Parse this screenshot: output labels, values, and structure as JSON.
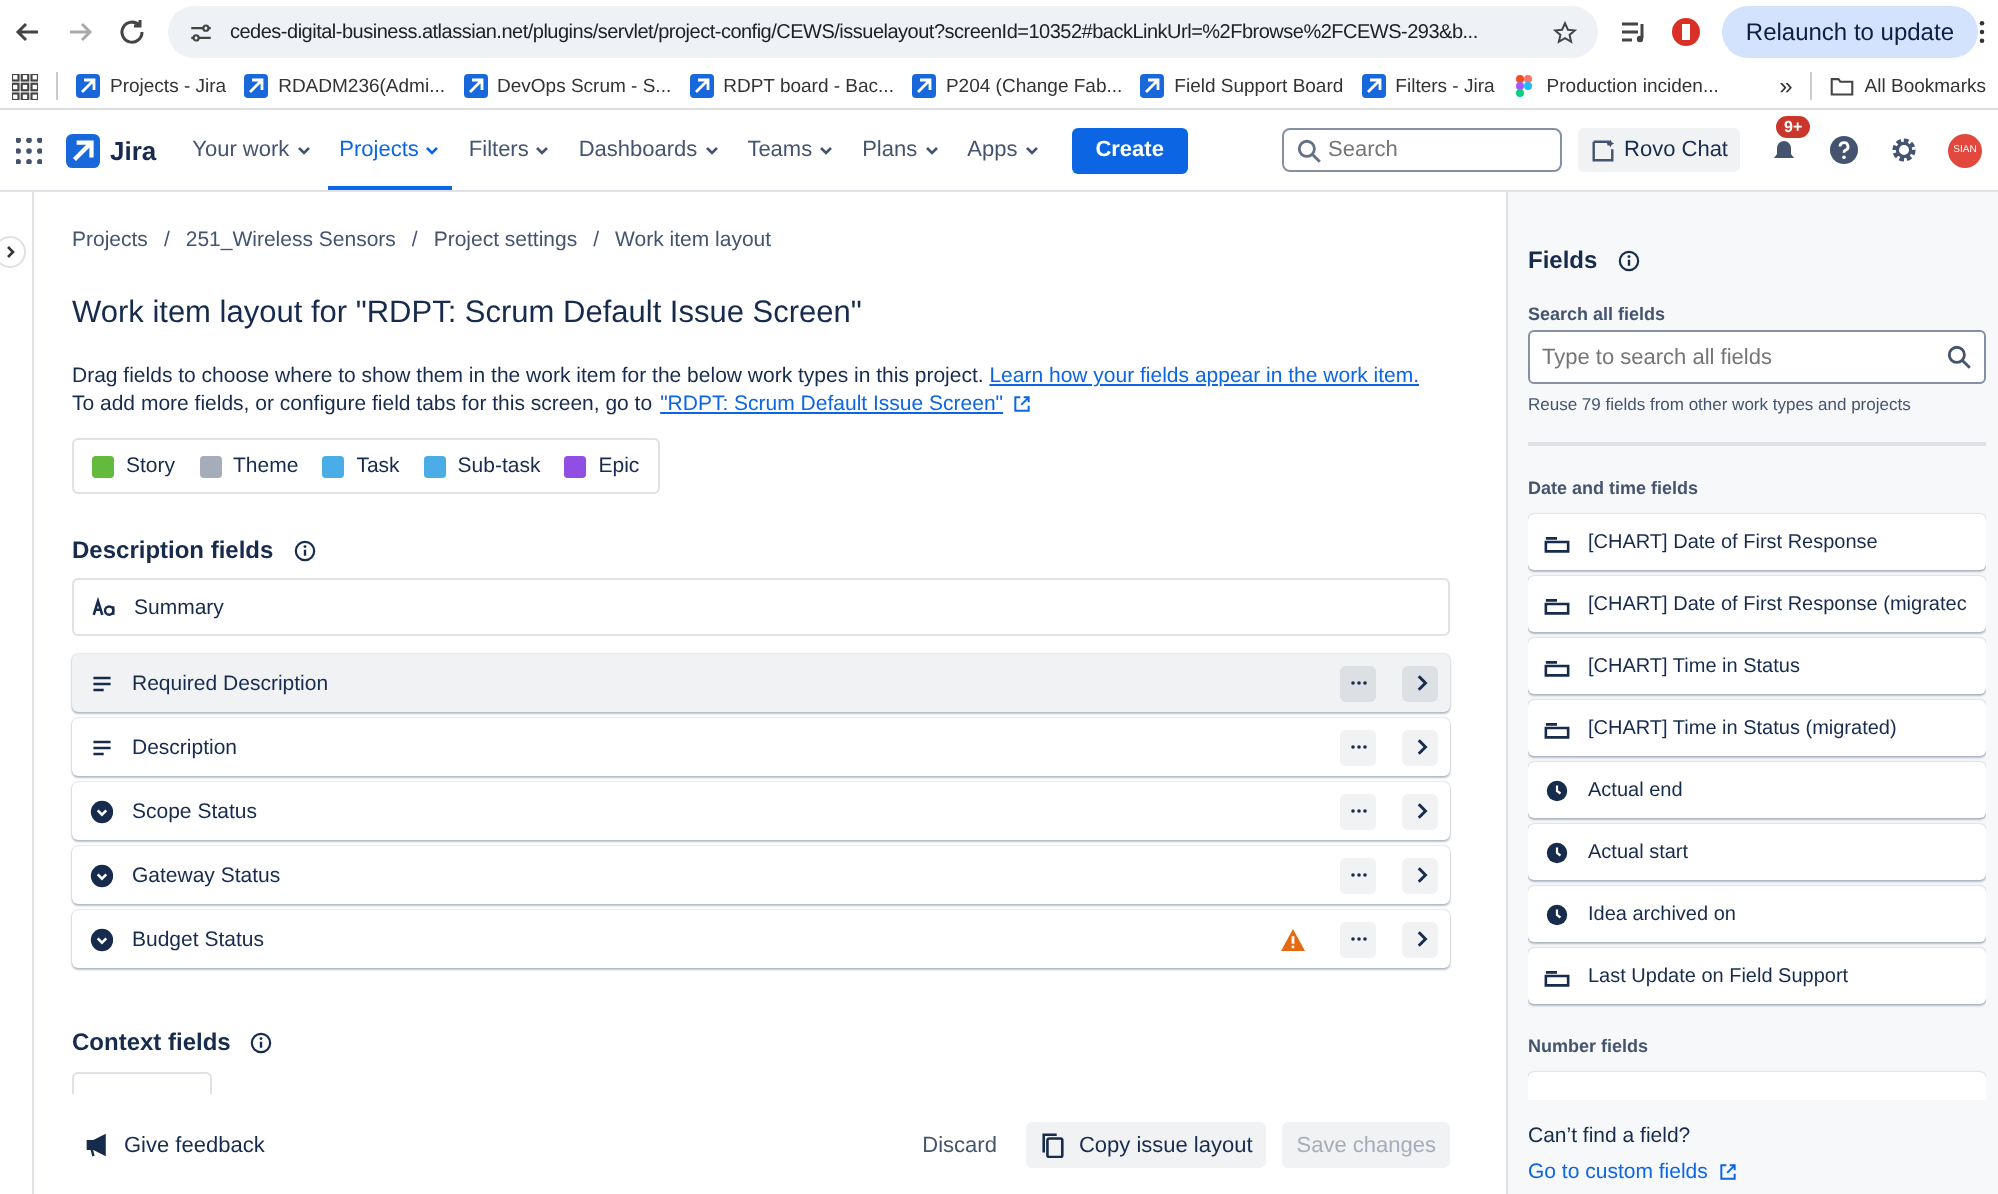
{
  "browser": {
    "url": "cedes-digital-business.atlassian.net/plugins/servlet/project-config/CEWS/issuelayout?screenId=10352#backLinkUrl=%2Fbrowse%2FCEWS-293&b...",
    "relaunch": "Relaunch to update",
    "bookmarks": [
      {
        "label": "Projects - Jira",
        "kind": "jira"
      },
      {
        "label": "RDADM236(Admi...",
        "kind": "jira"
      },
      {
        "label": "DevOps Scrum - S...",
        "kind": "jira"
      },
      {
        "label": "RDPT board - Bac...",
        "kind": "jira"
      },
      {
        "label": "P204 (Change Fab...",
        "kind": "jira"
      },
      {
        "label": "Field Support Board",
        "kind": "jira"
      },
      {
        "label": "Filters - Jira",
        "kind": "jira"
      },
      {
        "label": "Production inciden...",
        "kind": "figma"
      }
    ],
    "overflow": "»",
    "all_bookmarks": "All Bookmarks"
  },
  "nav": {
    "product": "Jira",
    "items": [
      {
        "label": "Your work",
        "selected": false
      },
      {
        "label": "Projects",
        "selected": true
      },
      {
        "label": "Filters",
        "selected": false
      },
      {
        "label": "Dashboards",
        "selected": false
      },
      {
        "label": "Teams",
        "selected": false
      },
      {
        "label": "Plans",
        "selected": false
      },
      {
        "label": "Apps",
        "selected": false
      }
    ],
    "create": "Create",
    "search_placeholder": "Search",
    "rovo": "Rovo Chat",
    "badge": "9+",
    "avatar": "SIAN"
  },
  "breadcrumb_separator": "/",
  "breadcrumbs": [
    "Projects",
    "251_Wireless Sensors",
    "Project settings",
    "Work item layout"
  ],
  "title": "Work item layout for \"RDPT: Scrum Default Issue Screen\"",
  "intro": {
    "text": "Drag fields to choose where to show them in the work item for the below work types in this project.",
    "link": "Learn how your fields appear in the work item.",
    "text2": "To add more fields, or configure field tabs for this screen, go to",
    "link2": "\"RDPT: Scrum Default Issue Screen\""
  },
  "work_types": [
    {
      "label": "Story",
      "color": "#63ba3c"
    },
    {
      "label": "Theme",
      "color": "#a5adba"
    },
    {
      "label": "Task",
      "color": "#4bade8"
    },
    {
      "label": "Sub-task",
      "color": "#4bade8"
    },
    {
      "label": "Epic",
      "color": "#904ee2"
    }
  ],
  "description_fields": {
    "heading": "Description fields",
    "fields": [
      {
        "label": "Summary",
        "kind": "text",
        "hovered": false,
        "warning": false,
        "actions": false
      },
      {
        "label": "Required Description",
        "kind": "paragraph",
        "hovered": true,
        "warning": false,
        "actions": true
      },
      {
        "label": "Description",
        "kind": "paragraph",
        "hovered": false,
        "warning": false,
        "actions": true
      },
      {
        "label": "Scope Status",
        "kind": "select",
        "hovered": false,
        "warning": false,
        "actions": true
      },
      {
        "label": "Gateway Status",
        "kind": "select",
        "hovered": false,
        "warning": false,
        "actions": true
      },
      {
        "label": "Budget Status",
        "kind": "select",
        "hovered": false,
        "warning": true,
        "actions": true
      }
    ]
  },
  "context_fields": {
    "heading": "Context fields"
  },
  "footer": {
    "feedback": "Give feedback",
    "discard": "Discard",
    "copy": "Copy issue layout",
    "save": "Save changes",
    "save_disabled": true
  },
  "fields_panel": {
    "title": "Fields",
    "search_label": "Search all fields",
    "placeholder": "Type to search all fields",
    "hint": "Reuse 79 fields from other work types and projects",
    "groups": [
      {
        "heading": "Date and time fields",
        "fields": [
          {
            "label": "[CHART] Date of First Response",
            "kind": "date"
          },
          {
            "label": "[CHART] Date of First Response (migratec",
            "kind": "date"
          },
          {
            "label": "[CHART] Time in Status",
            "kind": "date"
          },
          {
            "label": "[CHART] Time in Status (migrated)",
            "kind": "date"
          },
          {
            "label": "Actual end",
            "kind": "time"
          },
          {
            "label": "Actual start",
            "kind": "time"
          },
          {
            "label": "Idea archived on",
            "kind": "time"
          },
          {
            "label": "Last Update on Field Support",
            "kind": "date"
          }
        ]
      },
      {
        "heading": "Number fields"
      }
    ],
    "cant_find": "Can’t find a field?",
    "custom_link": "Go to custom fields"
  }
}
